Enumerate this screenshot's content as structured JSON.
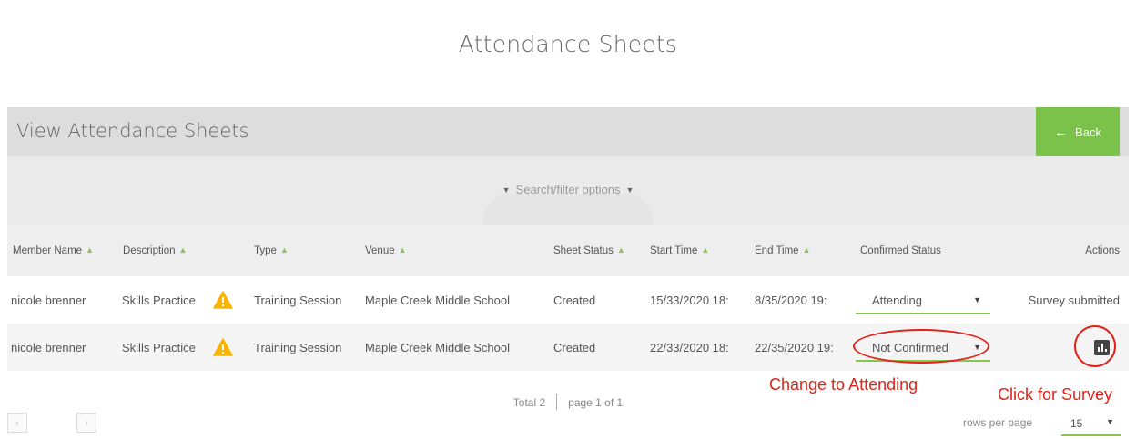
{
  "page": {
    "title": "Attendance Sheets"
  },
  "header": {
    "title": "View Attendance Sheets",
    "back_label": "Back"
  },
  "filter": {
    "label": "Search/filter options"
  },
  "table": {
    "columns": [
      "Member Name",
      "Description",
      "Type",
      "Venue",
      "Sheet Status",
      "Start Time",
      "End Time",
      "Confirmed Status",
      "Actions"
    ],
    "rows": [
      {
        "member": "nicole brenner",
        "description": "Skills Practice",
        "type": "Training Session",
        "venue": "Maple Creek Middle School",
        "sheet_status": "Created",
        "start": "15/33/2020 18:",
        "end": "8/35/2020 19:",
        "confirmed": "Attending",
        "action": "Survey submitted"
      },
      {
        "member": "nicole brenner",
        "description": "Skills Practice",
        "type": "Training Session",
        "venue": "Maple Creek Middle School",
        "sheet_status": "Created",
        "start": "22/33/2020 18:",
        "end": "22/35/2020 19:",
        "confirmed": "Not Confirmed",
        "action": ""
      }
    ]
  },
  "annotations": {
    "change": "Change to Attending",
    "survey": "Click for Survey",
    "color": "#e0231a"
  },
  "pagination": {
    "total": "Total 2",
    "page": "page 1 of 1",
    "rows_label": "rows per page",
    "rows_value": "15"
  },
  "colors": {
    "accent": "#7bc24a",
    "header_bg": "#dddddd"
  }
}
